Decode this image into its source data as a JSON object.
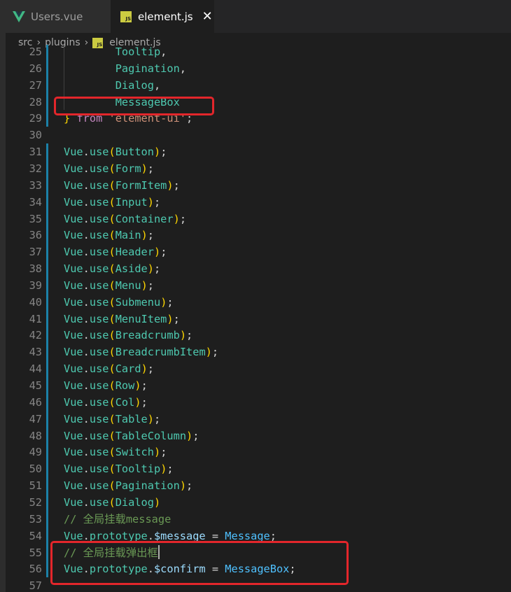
{
  "tabs": [
    {
      "label": "Users.vue",
      "icon": "vue-icon",
      "active": false
    },
    {
      "label": "element.js",
      "icon": "js-file-icon",
      "active": true
    }
  ],
  "breadcrumb": {
    "parts": [
      "src",
      "plugins",
      "element.js"
    ],
    "file_icon_text": "JS"
  },
  "colors": {
    "variable": "#4ec9b0",
    "property": "#9cdcfe",
    "keyword": "#c586c0",
    "string": "#ce9178",
    "comment": "#6a9955",
    "bracket": "#ffd700",
    "highlight_box": "#e3262b",
    "modified_bar": "#1b81a8"
  },
  "lines": [
    {
      "n": "25",
      "indent": "        ",
      "tokens": [
        [
          "Tooltip",
          "var"
        ],
        [
          ",",
          "punct"
        ]
      ]
    },
    {
      "n": "26",
      "indent": "        ",
      "tokens": [
        [
          "Pagination",
          "var"
        ],
        [
          ",",
          "punct"
        ]
      ]
    },
    {
      "n": "27",
      "indent": "        ",
      "tokens": [
        [
          "Dialog",
          "var"
        ],
        [
          ",",
          "punct"
        ]
      ]
    },
    {
      "n": "28",
      "indent": "        ",
      "tokens": [
        [
          "MessageBox",
          "var"
        ]
      ]
    },
    {
      "n": "29",
      "indent": "",
      "tokens": [
        [
          "}",
          "paren"
        ],
        [
          " ",
          "punct"
        ],
        [
          "from",
          "kw"
        ],
        [
          " ",
          "punct"
        ],
        [
          "'element-ui'",
          "str"
        ],
        [
          ";",
          "punct"
        ]
      ]
    },
    {
      "n": "30",
      "indent": "",
      "tokens": []
    },
    {
      "n": "31",
      "indent": "",
      "tokens": [
        [
          "Vue",
          "var"
        ],
        [
          ".",
          "punct"
        ],
        [
          "use",
          "var"
        ],
        [
          "(",
          "paren"
        ],
        [
          "Button",
          "var"
        ],
        [
          ")",
          "paren"
        ],
        [
          ";",
          "punct"
        ]
      ]
    },
    {
      "n": "32",
      "indent": "",
      "tokens": [
        [
          "Vue",
          "var"
        ],
        [
          ".",
          "punct"
        ],
        [
          "use",
          "var"
        ],
        [
          "(",
          "paren"
        ],
        [
          "Form",
          "var"
        ],
        [
          ")",
          "paren"
        ],
        [
          ";",
          "punct"
        ]
      ]
    },
    {
      "n": "33",
      "indent": "",
      "tokens": [
        [
          "Vue",
          "var"
        ],
        [
          ".",
          "punct"
        ],
        [
          "use",
          "var"
        ],
        [
          "(",
          "paren"
        ],
        [
          "FormItem",
          "var"
        ],
        [
          ")",
          "paren"
        ],
        [
          ";",
          "punct"
        ]
      ]
    },
    {
      "n": "34",
      "indent": "",
      "tokens": [
        [
          "Vue",
          "var"
        ],
        [
          ".",
          "punct"
        ],
        [
          "use",
          "var"
        ],
        [
          "(",
          "paren"
        ],
        [
          "Input",
          "var"
        ],
        [
          ")",
          "paren"
        ],
        [
          ";",
          "punct"
        ]
      ]
    },
    {
      "n": "35",
      "indent": "",
      "tokens": [
        [
          "Vue",
          "var"
        ],
        [
          ".",
          "punct"
        ],
        [
          "use",
          "var"
        ],
        [
          "(",
          "paren"
        ],
        [
          "Container",
          "var"
        ],
        [
          ")",
          "paren"
        ],
        [
          ";",
          "punct"
        ]
      ]
    },
    {
      "n": "36",
      "indent": "",
      "tokens": [
        [
          "Vue",
          "var"
        ],
        [
          ".",
          "punct"
        ],
        [
          "use",
          "var"
        ],
        [
          "(",
          "paren"
        ],
        [
          "Main",
          "var"
        ],
        [
          ")",
          "paren"
        ],
        [
          ";",
          "punct"
        ]
      ]
    },
    {
      "n": "37",
      "indent": "",
      "tokens": [
        [
          "Vue",
          "var"
        ],
        [
          ".",
          "punct"
        ],
        [
          "use",
          "var"
        ],
        [
          "(",
          "paren"
        ],
        [
          "Header",
          "var"
        ],
        [
          ")",
          "paren"
        ],
        [
          ";",
          "punct"
        ]
      ]
    },
    {
      "n": "38",
      "indent": "",
      "tokens": [
        [
          "Vue",
          "var"
        ],
        [
          ".",
          "punct"
        ],
        [
          "use",
          "var"
        ],
        [
          "(",
          "paren"
        ],
        [
          "Aside",
          "var"
        ],
        [
          ")",
          "paren"
        ],
        [
          ";",
          "punct"
        ]
      ]
    },
    {
      "n": "39",
      "indent": "",
      "tokens": [
        [
          "Vue",
          "var"
        ],
        [
          ".",
          "punct"
        ],
        [
          "use",
          "var"
        ],
        [
          "(",
          "paren"
        ],
        [
          "Menu",
          "var"
        ],
        [
          ")",
          "paren"
        ],
        [
          ";",
          "punct"
        ]
      ]
    },
    {
      "n": "40",
      "indent": "",
      "tokens": [
        [
          "Vue",
          "var"
        ],
        [
          ".",
          "punct"
        ],
        [
          "use",
          "var"
        ],
        [
          "(",
          "paren"
        ],
        [
          "Submenu",
          "var"
        ],
        [
          ")",
          "paren"
        ],
        [
          ";",
          "punct"
        ]
      ]
    },
    {
      "n": "41",
      "indent": "",
      "tokens": [
        [
          "Vue",
          "var"
        ],
        [
          ".",
          "punct"
        ],
        [
          "use",
          "var"
        ],
        [
          "(",
          "paren"
        ],
        [
          "MenuItem",
          "var"
        ],
        [
          ")",
          "paren"
        ],
        [
          ";",
          "punct"
        ]
      ]
    },
    {
      "n": "42",
      "indent": "",
      "tokens": [
        [
          "Vue",
          "var"
        ],
        [
          ".",
          "punct"
        ],
        [
          "use",
          "var"
        ],
        [
          "(",
          "paren"
        ],
        [
          "Breadcrumb",
          "var"
        ],
        [
          ")",
          "paren"
        ],
        [
          ";",
          "punct"
        ]
      ]
    },
    {
      "n": "43",
      "indent": "",
      "tokens": [
        [
          "Vue",
          "var"
        ],
        [
          ".",
          "punct"
        ],
        [
          "use",
          "var"
        ],
        [
          "(",
          "paren"
        ],
        [
          "BreadcrumbItem",
          "var"
        ],
        [
          ")",
          "paren"
        ],
        [
          ";",
          "punct"
        ]
      ]
    },
    {
      "n": "44",
      "indent": "",
      "tokens": [
        [
          "Vue",
          "var"
        ],
        [
          ".",
          "punct"
        ],
        [
          "use",
          "var"
        ],
        [
          "(",
          "paren"
        ],
        [
          "Card",
          "var"
        ],
        [
          ")",
          "paren"
        ],
        [
          ";",
          "punct"
        ]
      ]
    },
    {
      "n": "45",
      "indent": "",
      "tokens": [
        [
          "Vue",
          "var"
        ],
        [
          ".",
          "punct"
        ],
        [
          "use",
          "var"
        ],
        [
          "(",
          "paren"
        ],
        [
          "Row",
          "var"
        ],
        [
          ")",
          "paren"
        ],
        [
          ";",
          "punct"
        ]
      ]
    },
    {
      "n": "46",
      "indent": "",
      "tokens": [
        [
          "Vue",
          "var"
        ],
        [
          ".",
          "punct"
        ],
        [
          "use",
          "var"
        ],
        [
          "(",
          "paren"
        ],
        [
          "Col",
          "var"
        ],
        [
          ")",
          "paren"
        ],
        [
          ";",
          "punct"
        ]
      ]
    },
    {
      "n": "47",
      "indent": "",
      "tokens": [
        [
          "Vue",
          "var"
        ],
        [
          ".",
          "punct"
        ],
        [
          "use",
          "var"
        ],
        [
          "(",
          "paren"
        ],
        [
          "Table",
          "var"
        ],
        [
          ")",
          "paren"
        ],
        [
          ";",
          "punct"
        ]
      ]
    },
    {
      "n": "48",
      "indent": "",
      "tokens": [
        [
          "Vue",
          "var"
        ],
        [
          ".",
          "punct"
        ],
        [
          "use",
          "var"
        ],
        [
          "(",
          "paren"
        ],
        [
          "TableColumn",
          "var"
        ],
        [
          ")",
          "paren"
        ],
        [
          ";",
          "punct"
        ]
      ]
    },
    {
      "n": "49",
      "indent": "",
      "tokens": [
        [
          "Vue",
          "var"
        ],
        [
          ".",
          "punct"
        ],
        [
          "use",
          "var"
        ],
        [
          "(",
          "paren"
        ],
        [
          "Switch",
          "var"
        ],
        [
          ")",
          "paren"
        ],
        [
          ";",
          "punct"
        ]
      ]
    },
    {
      "n": "50",
      "indent": "",
      "tokens": [
        [
          "Vue",
          "var"
        ],
        [
          ".",
          "punct"
        ],
        [
          "use",
          "var"
        ],
        [
          "(",
          "paren"
        ],
        [
          "Tooltip",
          "var"
        ],
        [
          ")",
          "paren"
        ],
        [
          ";",
          "punct"
        ]
      ]
    },
    {
      "n": "51",
      "indent": "",
      "tokens": [
        [
          "Vue",
          "var"
        ],
        [
          ".",
          "punct"
        ],
        [
          "use",
          "var"
        ],
        [
          "(",
          "paren"
        ],
        [
          "Pagination",
          "var"
        ],
        [
          ")",
          "paren"
        ],
        [
          ";",
          "punct"
        ]
      ]
    },
    {
      "n": "52",
      "indent": "",
      "tokens": [
        [
          "Vue",
          "var"
        ],
        [
          ".",
          "punct"
        ],
        [
          "use",
          "var"
        ],
        [
          "(",
          "paren"
        ],
        [
          "Dialog",
          "var"
        ],
        [
          ")",
          "paren"
        ]
      ]
    },
    {
      "n": "53",
      "indent": "",
      "tokens": [
        [
          "// 全局挂载message",
          "comment"
        ]
      ]
    },
    {
      "n": "54",
      "indent": "",
      "tokens": [
        [
          "Vue",
          "var"
        ],
        [
          ".",
          "punct"
        ],
        [
          "prototype",
          "var"
        ],
        [
          ".",
          "punct"
        ],
        [
          "$message",
          "prop"
        ],
        [
          " = ",
          "punct"
        ],
        [
          "Message",
          "const"
        ],
        [
          ";",
          "punct"
        ]
      ]
    },
    {
      "n": "55",
      "indent": "",
      "tokens": [
        [
          "// 全局挂载弹出框",
          "comment"
        ]
      ],
      "cursor": true
    },
    {
      "n": "56",
      "indent": "",
      "tokens": [
        [
          "Vue",
          "var"
        ],
        [
          ".",
          "punct"
        ],
        [
          "prototype",
          "var"
        ],
        [
          ".",
          "punct"
        ],
        [
          "$confirm",
          "prop"
        ],
        [
          " = ",
          "punct"
        ],
        [
          "MessageBox",
          "const"
        ],
        [
          ";",
          "punct"
        ]
      ]
    },
    {
      "n": "57",
      "indent": "",
      "tokens": []
    }
  ]
}
